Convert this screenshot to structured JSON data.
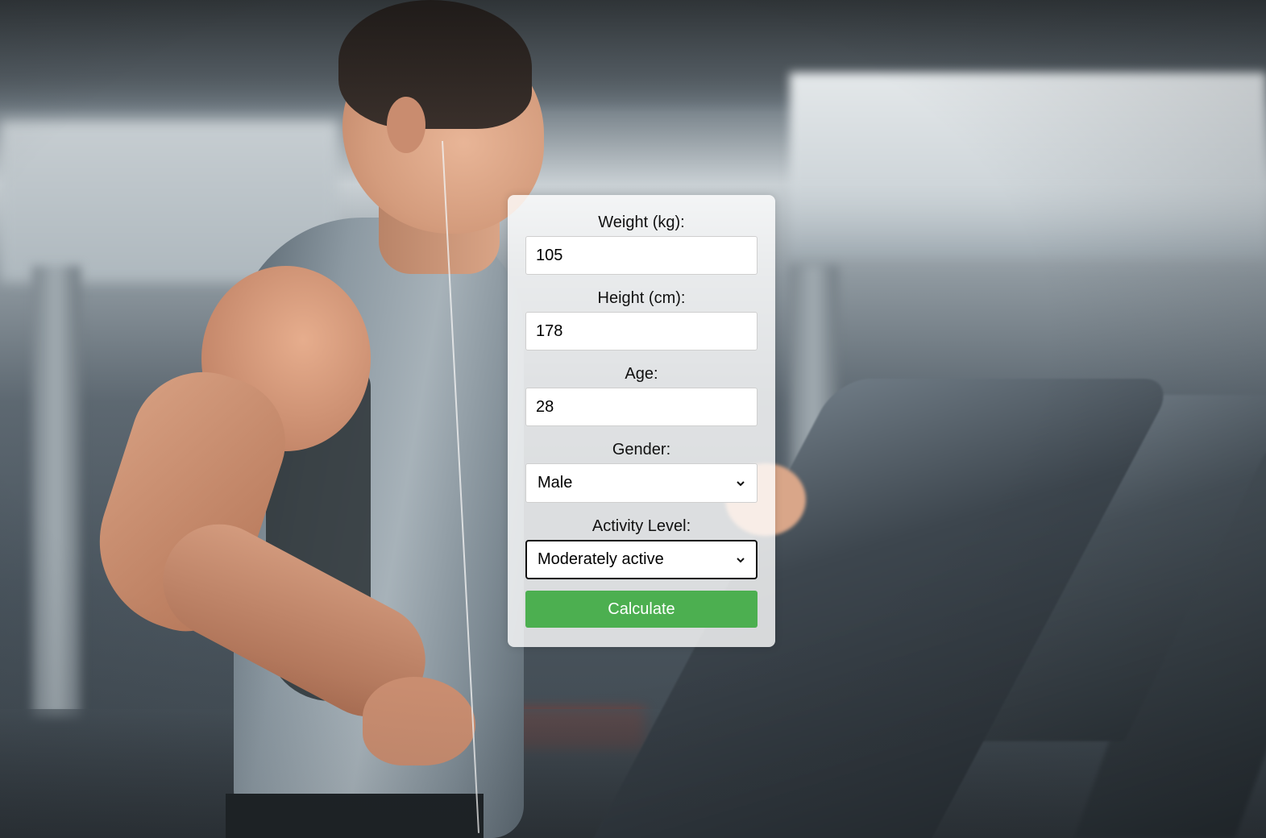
{
  "form": {
    "weight": {
      "label": "Weight (kg):",
      "value": "105"
    },
    "height": {
      "label": "Height (cm):",
      "value": "178"
    },
    "age": {
      "label": "Age:",
      "value": "28"
    },
    "gender": {
      "label": "Gender:",
      "selected": "Male"
    },
    "activity": {
      "label": "Activity Level:",
      "selected": "Moderately active"
    },
    "submit_label": "Calculate"
  },
  "colors": {
    "button": "#4caf50",
    "card_background": "rgba(255,255,255,0.8)"
  },
  "icons": {
    "select_arrow": "chevron-down-icon"
  }
}
